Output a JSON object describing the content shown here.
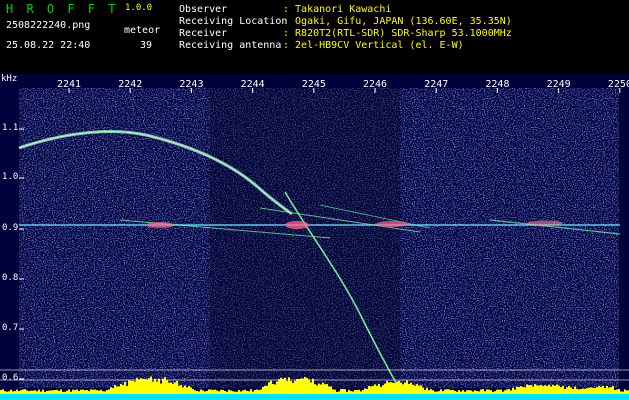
{
  "header": {
    "app_title": "H R O F F T",
    "app_version": "1.0.0",
    "file_name": "2508222240.png",
    "datetime": "25.08.22 22:40",
    "mode": "meteor",
    "count": "39",
    "info": [
      {
        "label": "Observer",
        "value": ": Takanori Kawachi"
      },
      {
        "label": "Receiving Location",
        "value": ": Ogaki, Gifu, JAPAN (136.60E, 35.35N)"
      },
      {
        "label": "Receiver",
        "value": ": R820T2(RTL-SDR) SDR-Sharp 53.1000MHz"
      },
      {
        "label": "Receiving antenna",
        "value": ": 2el-HB9CV Vertical (el. E-W)"
      }
    ]
  },
  "axes": {
    "y_unit": "kHz",
    "x_ticks": [
      "2241",
      "2242",
      "2243",
      "2244",
      "2245",
      "2246",
      "2247",
      "2248",
      "2249",
      "2250"
    ],
    "y_ticks": [
      "1.1",
      "1.0",
      "0.9",
      "0.8",
      "0.7",
      "0.6"
    ]
  },
  "colors": {
    "background": "#00003a",
    "axis_text": "#ffffff",
    "header_value": "#ffff00",
    "title": "#00d000",
    "level_bar": "#ffff00",
    "floor_bar": "#00e0ff"
  }
}
